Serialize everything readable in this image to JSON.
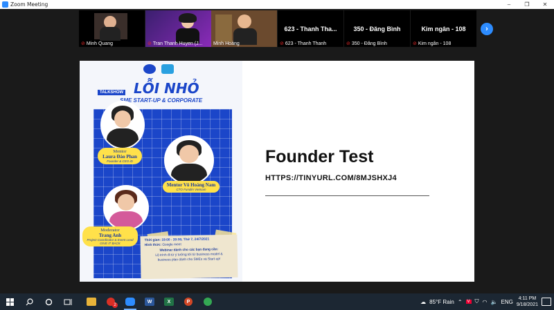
{
  "window": {
    "title": "Zoom Meeting",
    "controls": [
      "–",
      "❐",
      "✕"
    ]
  },
  "participants": [
    {
      "name": "Minh Quang",
      "kind": "video",
      "muted": true
    },
    {
      "name": "Tran Thanh Huyen (J...",
      "kind": "video",
      "muted": true
    },
    {
      "name": "Minh Hoàng",
      "kind": "video",
      "muted": false,
      "active": true
    },
    {
      "name": "623 - Thanh Thanh",
      "kind": "text",
      "display": "623 - Thanh Tha...",
      "muted": true
    },
    {
      "name": "350 - Đăng Bình",
      "kind": "text",
      "display": "350 - Đăng Bình",
      "muted": true
    },
    {
      "name": "Kim ngân - 108",
      "kind": "text",
      "display": "Kim ngân - 108",
      "muted": true
    }
  ],
  "next_label": "›",
  "slide": {
    "poster": {
      "talkshow": "TALKSHOW",
      "headline": "LỖI NHỎ",
      "subheadline": "SME START-UP & CORPORATE",
      "mentor1": {
        "role": "Mentor",
        "name": "Laura Đào Phan",
        "title": "Founder & CEO iD"
      },
      "mentor2": {
        "role": "Mentor",
        "name": "Võ Hoàng Nam",
        "title": "CTO Fundiin Vietnam"
      },
      "moderator": {
        "role": "Moderator",
        "name": "Trang Anh",
        "title": "Project Coordinator & Event Lead",
        "org": "GIVE IT BACK"
      },
      "time_label": "Thời gian:",
      "time_value": "19:00 - 20:30, Thứ 7, 24/7/2021",
      "format_label": "Hình thức:",
      "format_value": "Google meet",
      "audience_title": "Webinar dành cho các bạn đang cần:",
      "audience_line1": "Lộ trình đi từ ý tưởng tới từ business model &",
      "audience_line2": "business plan dành cho SMEs và Start-up!"
    },
    "title": "Founder Test",
    "link": "HTTPS://TINYURL.COM/8MJSHXJ4"
  },
  "taskbar": {
    "apps": [
      {
        "name": "file-explorer",
        "color": "#e8b339",
        "label": ""
      },
      {
        "name": "chrome",
        "color": "#d93025",
        "label": "",
        "badge": "2"
      },
      {
        "name": "zoom",
        "color": "#2d8cff",
        "label": "",
        "active": true
      },
      {
        "name": "word",
        "color": "#2b579a",
        "label": "W"
      },
      {
        "name": "excel",
        "color": "#217346",
        "label": "X"
      },
      {
        "name": "powerpoint",
        "color": "#d24726",
        "label": "P"
      },
      {
        "name": "chrome-2",
        "color": "#34a853",
        "label": ""
      }
    ],
    "weather": "85°F Rain",
    "language": "ENG",
    "time": "4:11 PM",
    "date": "9/18/2021"
  }
}
